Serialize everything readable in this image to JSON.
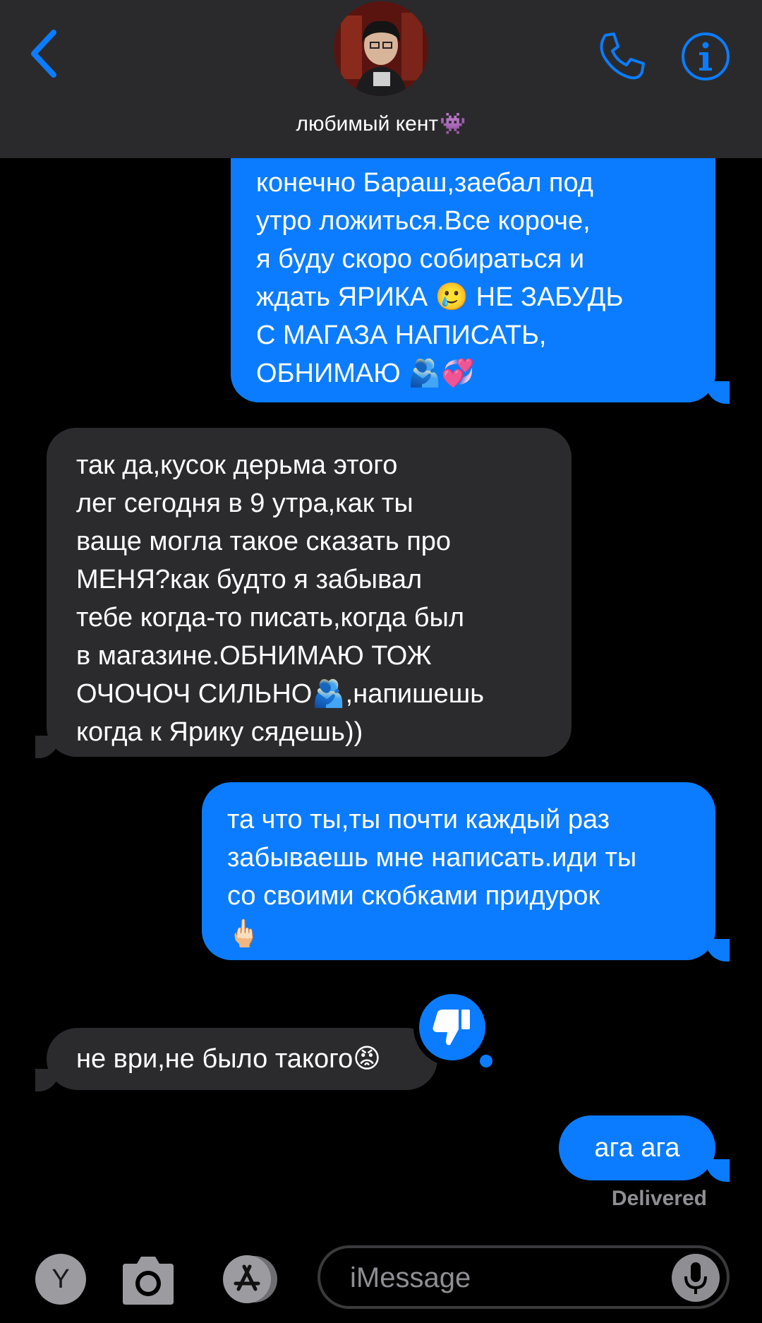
{
  "header": {
    "contact_name": "любимый кент",
    "contact_emoji": "👾"
  },
  "messages": [
    {
      "direction": "sent",
      "text": "конечно Бараш,заебал под\nутро ложиться.Все короче,\nя буду скоро собираться и\nждать ЯРИКА 🥲 НЕ ЗАБУДЬ\nС МАГАЗА НАПИСАТЬ,\nОБНИМАЮ 🫂💞"
    },
    {
      "direction": "received",
      "text": "так да,кусок дерьма этого\nлег сегодня в 9 утра,как ты\nваще могла такое сказать про\nМЕНЯ?как будто я забывал\nтебе когда-то писать,когда был\nв магазине.ОБНИМАЮ ТОЖ\nОЧОЧОЧ СИЛЬНО🫂,напишешь\nкогда к Ярику сядешь))"
    },
    {
      "direction": "sent",
      "text": "та что ты,ты почти каждый раз\nзабываешь мне написать.иди ты\nсо своими скобками придурок\n🖕🏻"
    },
    {
      "direction": "received",
      "text": "не ври,не было такого😡",
      "reaction": "thumbs-down"
    },
    {
      "direction": "sent",
      "text": "ага ага"
    }
  ],
  "status": {
    "delivered": "Delivered"
  },
  "compose": {
    "y_label": "Y",
    "placeholder": "iMessage"
  },
  "colors": {
    "sent_bubble": "#0b7cff",
    "received_bubble": "#2b2b2e",
    "header_bg": "#2a2a2c",
    "accent": "#0b7cff"
  },
  "icons": {
    "back": "chevron-left-icon",
    "call": "phone-icon",
    "info": "info-icon",
    "reaction": "thumbs-down-icon",
    "camera": "camera-icon",
    "appstore": "app-store-icon",
    "mic": "microphone-icon"
  }
}
